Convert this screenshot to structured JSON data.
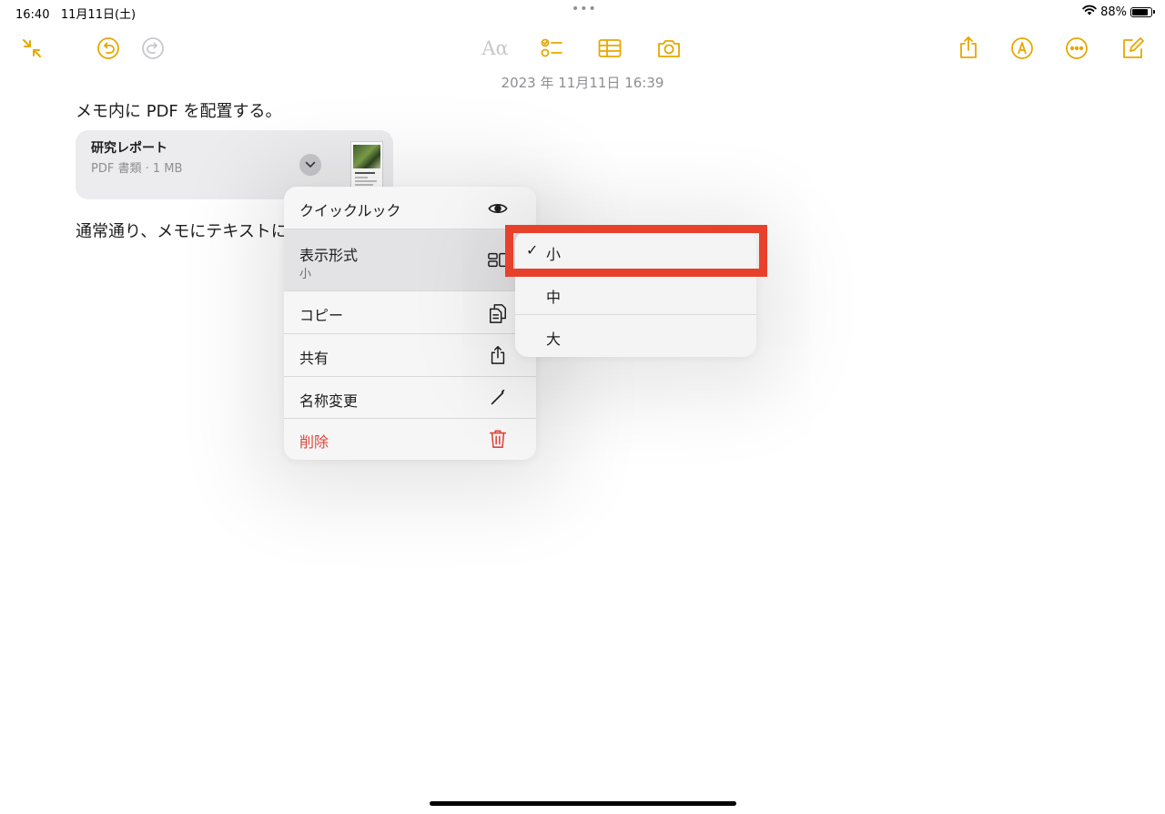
{
  "status_bar": {
    "time": "16:40",
    "date": "11月11日(土)",
    "dots": "•••",
    "battery_percent": "88%",
    "battery_level": 0.88,
    "icons": [
      "wifi-icon",
      "battery-icon"
    ]
  },
  "toolbar": {
    "text_format_label": "Aα",
    "icons": [
      "collapse-icon",
      "undo-icon",
      "redo-icon",
      "text-format-icon",
      "checklist-icon",
      "table-icon",
      "camera-icon",
      "share-icon",
      "markup-pen-icon",
      "more-icon",
      "compose-icon"
    ],
    "accent_color": "#e6a700",
    "disabled_color": "#c7c7cc"
  },
  "note": {
    "date": "2023 年 11月11日 16:39",
    "line1": "メモ内に PDF を配置する。",
    "line2": "通常通り、メモにテキストに"
  },
  "attachment": {
    "title": "研究レポート",
    "subtitle": "PDF 書類 · 1 MB"
  },
  "context_menu": {
    "items": [
      {
        "label": "クイックルック",
        "icon": "eye-icon"
      },
      {
        "label": "表示形式",
        "sublabel": "小",
        "icon": "view-format-icon"
      },
      {
        "label": "コピー",
        "icon": "copy-icon"
      },
      {
        "label": "共有",
        "icon": "share-icon"
      },
      {
        "label": "名称変更",
        "icon": "pencil-icon"
      },
      {
        "label": "削除",
        "icon": "trash-icon"
      }
    ],
    "destructive_color": "#e0443a"
  },
  "submenu": {
    "check": "✓",
    "items": [
      {
        "label": "小",
        "selected": true
      },
      {
        "label": "中",
        "selected": false
      },
      {
        "label": "大",
        "selected": false
      }
    ]
  },
  "highlight_color": "#e8412b"
}
